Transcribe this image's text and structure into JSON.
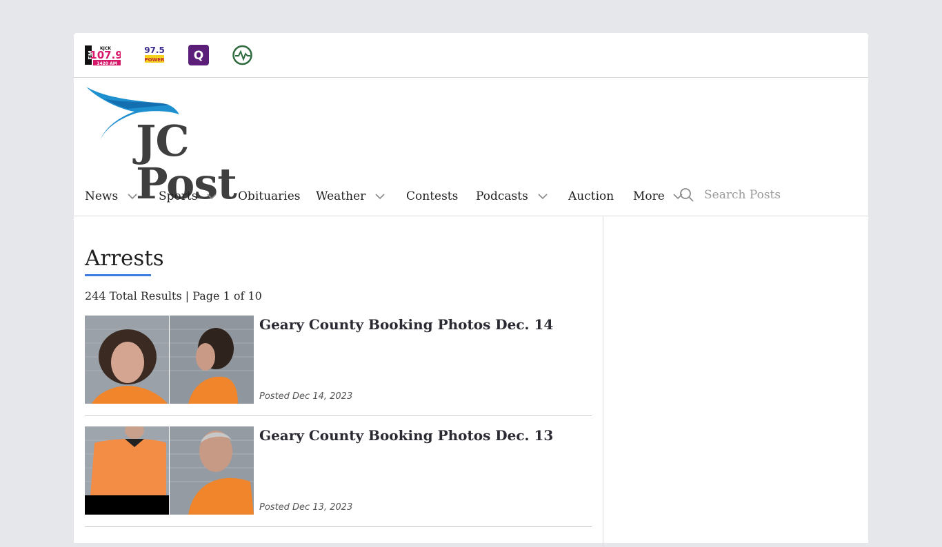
{
  "stations": [
    {
      "name": "kjck-107-9-logo",
      "label": "107.9"
    },
    {
      "name": "97-5-logo",
      "label": "97.5"
    },
    {
      "name": "q-logo",
      "label": "Q"
    },
    {
      "name": "pulse-logo",
      "label": ""
    }
  ],
  "brand": {
    "name": "JC Post",
    "color": "#3f3f3f",
    "accent": "#1e8fcf"
  },
  "nav": {
    "items": [
      {
        "label": "News",
        "dropdown": true
      },
      {
        "label": "Sports",
        "dropdown": true
      },
      {
        "label": "Obituaries",
        "dropdown": false
      },
      {
        "label": "Weather",
        "dropdown": true
      },
      {
        "label": "Contests",
        "dropdown": false
      },
      {
        "label": "Podcasts",
        "dropdown": true
      },
      {
        "label": "Auction",
        "dropdown": false
      },
      {
        "label": "More",
        "dropdown": true
      }
    ],
    "search_placeholder": "Search Posts"
  },
  "page": {
    "title": "Arrests",
    "results": "244 Total Results | Page 1 of 10",
    "accent": "#3b7de0"
  },
  "posts": [
    {
      "title": "Geary County Booking Photos Dec. 14",
      "date": "Posted Dec 14, 2023"
    },
    {
      "title": "Geary County Booking Photos Dec. 13",
      "date": "Posted Dec 13, 2023"
    }
  ]
}
